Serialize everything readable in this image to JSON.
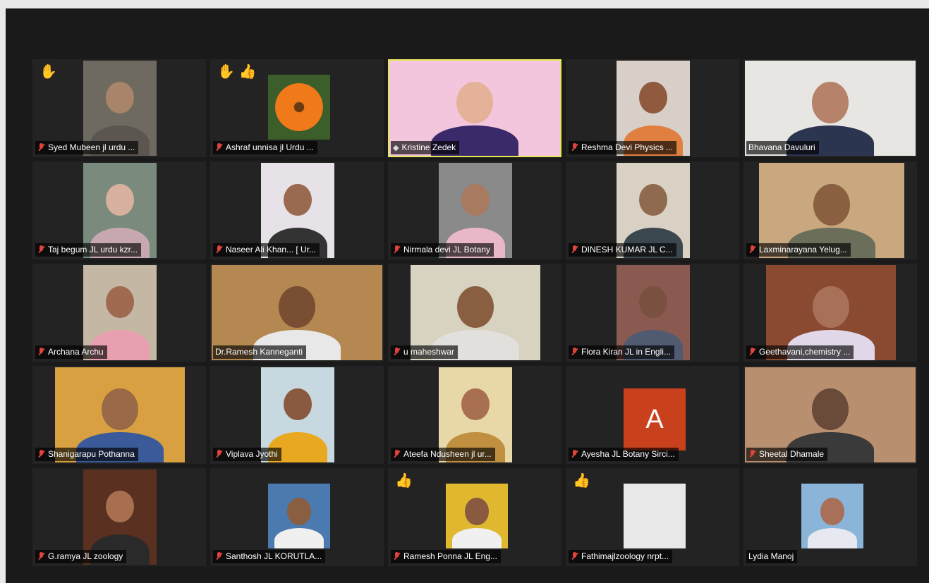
{
  "meeting": {
    "participants": [
      {
        "name": "Syed Mubeen jl urdu ...",
        "muted": true,
        "reactions": [
          "raised-hand"
        ],
        "video": "box",
        "bg": "#6e6a60",
        "skin": "#a8846a",
        "shirt": "#5c5650"
      },
      {
        "name": "Ashraf unnisa jl Urdu ...",
        "muted": true,
        "reactions": [
          "raised-hand",
          "thumbs-up"
        ],
        "video": "flower",
        "bg": "#3b5e2a",
        "skin": "#f07a1a",
        "shirt": "#e55a12"
      },
      {
        "name": "Kristine Zedek",
        "muted": false,
        "pinned": true,
        "active": true,
        "video": "full",
        "bg": "#f4c6de",
        "skin": "#e3b299",
        "shirt": "#3a2a6a"
      },
      {
        "name": "Reshma Devi Physics ...",
        "muted": true,
        "video": "box",
        "bg": "#d8d0c8",
        "skin": "#8f5a3e",
        "shirt": "#e08040"
      },
      {
        "name": "Bhavana Davuluri",
        "muted": false,
        "video": "full",
        "bg": "#e8e6e2",
        "skin": "#b6826a",
        "shirt": "#2c3550"
      },
      {
        "name": "Taj begum JL urdu kzr...",
        "muted": true,
        "video": "box",
        "bg": "#7a8a7c",
        "skin": "#d8b0a0",
        "shirt": "#c8a8b0"
      },
      {
        "name": "Naseer Ali Khan... [ Ur...",
        "muted": true,
        "video": "box",
        "bg": "#e6e2e8",
        "skin": "#9a6a50",
        "shirt": "#333333"
      },
      {
        "name": "Nirmala devi JL Botany",
        "muted": true,
        "video": "box",
        "bg": "#8a8a8a",
        "skin": "#a87a60",
        "shirt": "#e8b8c8"
      },
      {
        "name": "DINESH KUMAR JL C...",
        "muted": true,
        "video": "box",
        "bg": "#d9d2c4",
        "skin": "#8f6a4e",
        "shirt": "#3c4850"
      },
      {
        "name": "Laxminarayana Yelug...",
        "muted": true,
        "video": "wide",
        "bg": "#c9a880",
        "skin": "#8a6040",
        "shirt": "#6a6e5a"
      },
      {
        "name": "Archana Archu",
        "muted": true,
        "video": "box",
        "bg": "#c4b8a4",
        "skin": "#a06a50",
        "shirt": "#e8a0b0"
      },
      {
        "name": "Dr.Ramesh Kanneganti",
        "muted": false,
        "video": "full",
        "bg": "#b48850",
        "skin": "#7a4e32",
        "shirt": "#e8e8e8"
      },
      {
        "name": "u maheshwar",
        "muted": true,
        "video": "mid",
        "bg": "#d8d2c0",
        "skin": "#8a5e40",
        "shirt": "#e2e0dc"
      },
      {
        "name": "Flora Kiran JL in Engli...",
        "muted": true,
        "video": "box",
        "bg": "#8a5a50",
        "skin": "#7a5040",
        "shirt": "#505a70"
      },
      {
        "name": "Geethavani,chemistry ...",
        "muted": true,
        "video": "mid",
        "bg": "#8a4a32",
        "skin": "#a87058",
        "shirt": "#e0d8e8"
      },
      {
        "name": "Shanigarapu Pothanna",
        "muted": true,
        "video": "mid",
        "bg": "#d8a040",
        "skin": "#9a6a48",
        "shirt": "#3a5a9a"
      },
      {
        "name": "Viplava Jyothi",
        "muted": true,
        "video": "box",
        "bg": "#c8d8e0",
        "skin": "#8a5a40",
        "shirt": "#e8a820"
      },
      {
        "name": "Ateefa Ndusheen jl ur...",
        "muted": true,
        "video": "box",
        "bg": "#e8d8a8",
        "skin": "#a87050",
        "shirt": "#c09040"
      },
      {
        "name": "Ayesha JL Botany Sirci...",
        "muted": true,
        "video": "avatar",
        "avatar_letter": "A",
        "avatar_color": "#c9401c"
      },
      {
        "name": "Sheetal Dhamale",
        "muted": true,
        "video": "full",
        "bg": "#b89070",
        "skin": "#6a4a38",
        "shirt": "#3a3a3a"
      },
      {
        "name": "G.ramya JL zoology",
        "muted": true,
        "video": "box",
        "bg": "#5a3020",
        "skin": "#a86e50",
        "shirt": "#2a2a2a"
      },
      {
        "name": "Santhosh JL KORUTLA...",
        "muted": true,
        "video": "small",
        "bg": "#4a7ab0",
        "skin": "#8a5e40",
        "shirt": "#f0f0f0"
      },
      {
        "name": "Ramesh Ponna JL Eng...",
        "muted": true,
        "reactions": [
          "thumbs-up"
        ],
        "video": "small",
        "bg": "#e0b830",
        "skin": "#8a5a40",
        "shirt": "#f0f0f0"
      },
      {
        "name": "Fathimajlzoology nrpt...",
        "muted": true,
        "reactions": [
          "thumbs-up"
        ],
        "video": "small",
        "bg": "#e8e8e8",
        "skin": "#e8e8e8",
        "shirt": "#e8e8e8"
      },
      {
        "name": "Lydia Manoj",
        "muted": false,
        "video": "small",
        "bg": "#8ab4d8",
        "skin": "#a87058",
        "shirt": "#e8e8f0"
      }
    ]
  }
}
